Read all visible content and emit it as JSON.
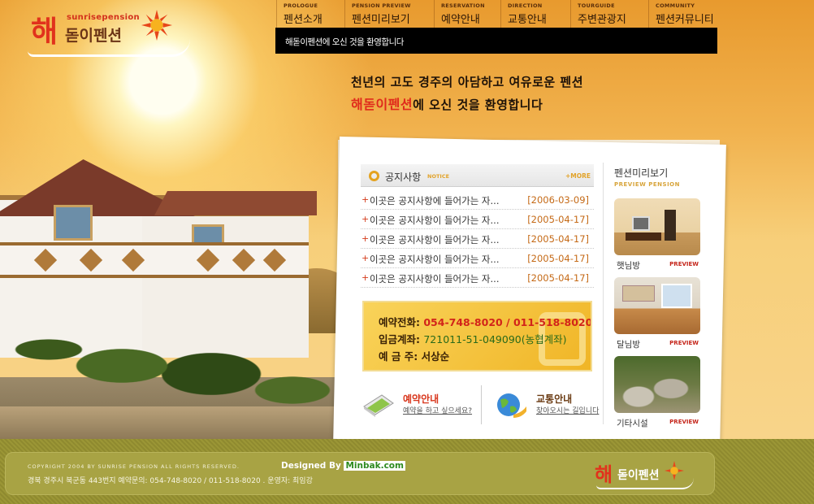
{
  "logo": {
    "han": "해",
    "eng": "sunrisepension",
    "ko": "돋이펜션"
  },
  "nav": [
    {
      "en": "PROLOGUE",
      "ko": "펜션소개"
    },
    {
      "en": "PENSION PREVIEW",
      "ko": "펜션미리보기"
    },
    {
      "en": "RESERVATION",
      "ko": "예약안내"
    },
    {
      "en": "DIRECTION",
      "ko": "교통안내"
    },
    {
      "en": "TOURGUIDE",
      "ko": "주변관광지"
    },
    {
      "en": "COMMUNITY",
      "ko": "펜션커뮤니티"
    }
  ],
  "banner": "해돋이펜션에 오신 것을 환영합니다",
  "tagline": {
    "line1": "천년의 고도 경주의 아담하고 여유로운 펜션",
    "brand": "해돋이펜션",
    "line2_rest": "에 오신 것을 환영합니다"
  },
  "notice": {
    "title": "공지사항",
    "en": "NOTICE",
    "more": "+MORE",
    "items": [
      {
        "text": "이곳은 공지사항에 들어가는 자...",
        "date": "[2006-03-09]"
      },
      {
        "text": "이곳은 공지사항이 들어가는 자...",
        "date": "[2005-04-17]"
      },
      {
        "text": "이곳은 공지사항이 들어가는 자...",
        "date": "[2005-04-17]"
      },
      {
        "text": "이곳은 공지사항이 들어가는 자...",
        "date": "[2005-04-17]"
      },
      {
        "text": "이곳은 공지사항이 들어가는 자...",
        "date": "[2005-04-17]"
      }
    ]
  },
  "contact": {
    "phone_label": "예약전화:",
    "phone": "054-748-8020 / 011-518-8020",
    "bank_label": "입금계좌:",
    "bank": "721011-51-049090(농협계좌)",
    "holder_label": "예 금 주:",
    "holder": "서상순"
  },
  "quick": {
    "reserve_title": "예약안내",
    "reserve_sub": "예약을 하고 싶으세요?",
    "traffic_title": "교통안내",
    "traffic_sub": "찾아오시는 길입니다"
  },
  "preview": {
    "title": "펜션미리보기",
    "en": "PREVIEW PENSION",
    "items": [
      {
        "name": "햇님방",
        "tag": "PREVIEW"
      },
      {
        "name": "달님방",
        "tag": "PREVIEW"
      },
      {
        "name": "기타시설",
        "tag": "PREVIEW"
      }
    ]
  },
  "footer": {
    "copyright": "COPYRIGHT 2004 BY SUNRISE PENSION ALL RIGHTS RESERVED.",
    "designed_by": "Designed By",
    "designed_site": "Minbak.com",
    "address": "경북 경주시 북군동 443번지 예약문의: 054-748-8020 / 011-518-8020 . 운영자: 최임강"
  },
  "colors": {
    "accent_red": "#e1321c",
    "gold": "#e2a32a",
    "footer_olive": "#9b9636"
  }
}
